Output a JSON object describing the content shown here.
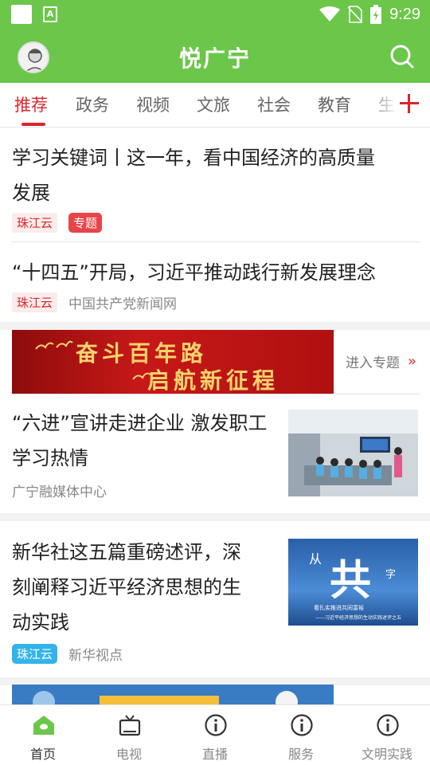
{
  "status_bar": {
    "time": "9:29",
    "left_icon": "A"
  },
  "header": {
    "title": "悦广宁"
  },
  "tabs": [
    "推荐",
    "政务",
    "视频",
    "文旅",
    "社会",
    "教育",
    "生"
  ],
  "articles": [
    {
      "title_line1": "学习关键词丨这一年，看中国经济的高质量",
      "title_line2": "发展",
      "tag": "珠江云",
      "badge": "专题"
    },
    {
      "title": "“十四五”开局，习近平推动践行新发展理念",
      "tag": "珠江云",
      "source": "中国共产党新闻网"
    },
    {
      "title_line1": "“六进”宣讲走进企业 激发职工",
      "title_line2": "学习热情",
      "source": "广宁融媒体中心"
    },
    {
      "title_line1": "新华社这五篇重磅述评，深",
      "title_line2": "刻阐释习近平经济思想的生",
      "title_line3": "动实践",
      "tag": "珠江云",
      "source": "新华视点"
    }
  ],
  "banner": {
    "line1": "奋斗百年路",
    "line2": "启航新征程",
    "link_label": "进入专题",
    "chevron": "»"
  },
  "thumb2": {
    "big_char": "共",
    "small_left": "从",
    "small_right": "字",
    "caption_line1": "看扎实推进共同富裕",
    "caption_line2": "——习近平经济思想的生动实践述评之五"
  },
  "bottom_nav": [
    "首页",
    "电视",
    "直播",
    "服务",
    "文明实践"
  ],
  "colors": {
    "brand_green": "#6cc64a",
    "accent_red": "#d9262b",
    "tag_blue": "#33b4e8"
  }
}
